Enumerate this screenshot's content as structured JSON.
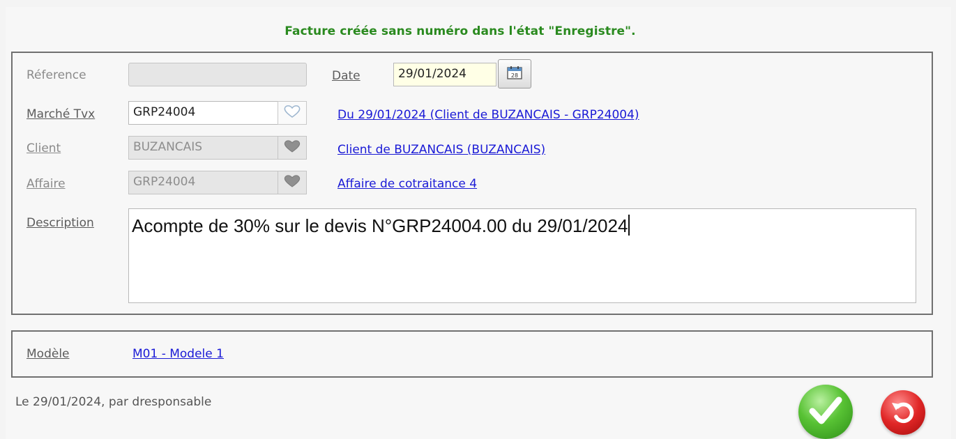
{
  "notice": "Facture créée sans numéro dans l'état \"Enregistre\".",
  "form": {
    "reference": {
      "label": "Réference",
      "value": ""
    },
    "date": {
      "label": "Date",
      "value": "29/01/2024",
      "calendar_icon": "calendar-icon"
    },
    "marche": {
      "label": "Marché Tvx",
      "value": "GRP24004",
      "link": "Du 29/01/2024 (Client de BUZANCAIS - GRP24004)",
      "icon": "heart-outline-icon"
    },
    "client": {
      "label": "Client",
      "value": "BUZANCAIS",
      "link": "Client de BUZANCAIS (BUZANCAIS)",
      "icon": "heart-filled-icon"
    },
    "affaire": {
      "label": "Affaire",
      "value": "GRP24004",
      "link": "Affaire de cotraitance 4",
      "icon": "heart-filled-icon"
    },
    "description": {
      "label": "Description",
      "value": "Acompte de 30% sur le devis N°GRP24004.00 du 29/01/2024"
    }
  },
  "model": {
    "label": "Modèle",
    "link": "M01 - Modele 1"
  },
  "footer": {
    "created": "Le 29/01/2024, par dresponsable"
  },
  "buttons": {
    "validate_icon": "checkmark-icon",
    "cancel_icon": "undo-icon"
  },
  "colors": {
    "notice": "#2a8a1f",
    "link": "#1a1ad6",
    "ok": "#3aa820",
    "cancel": "#d81e1e"
  }
}
